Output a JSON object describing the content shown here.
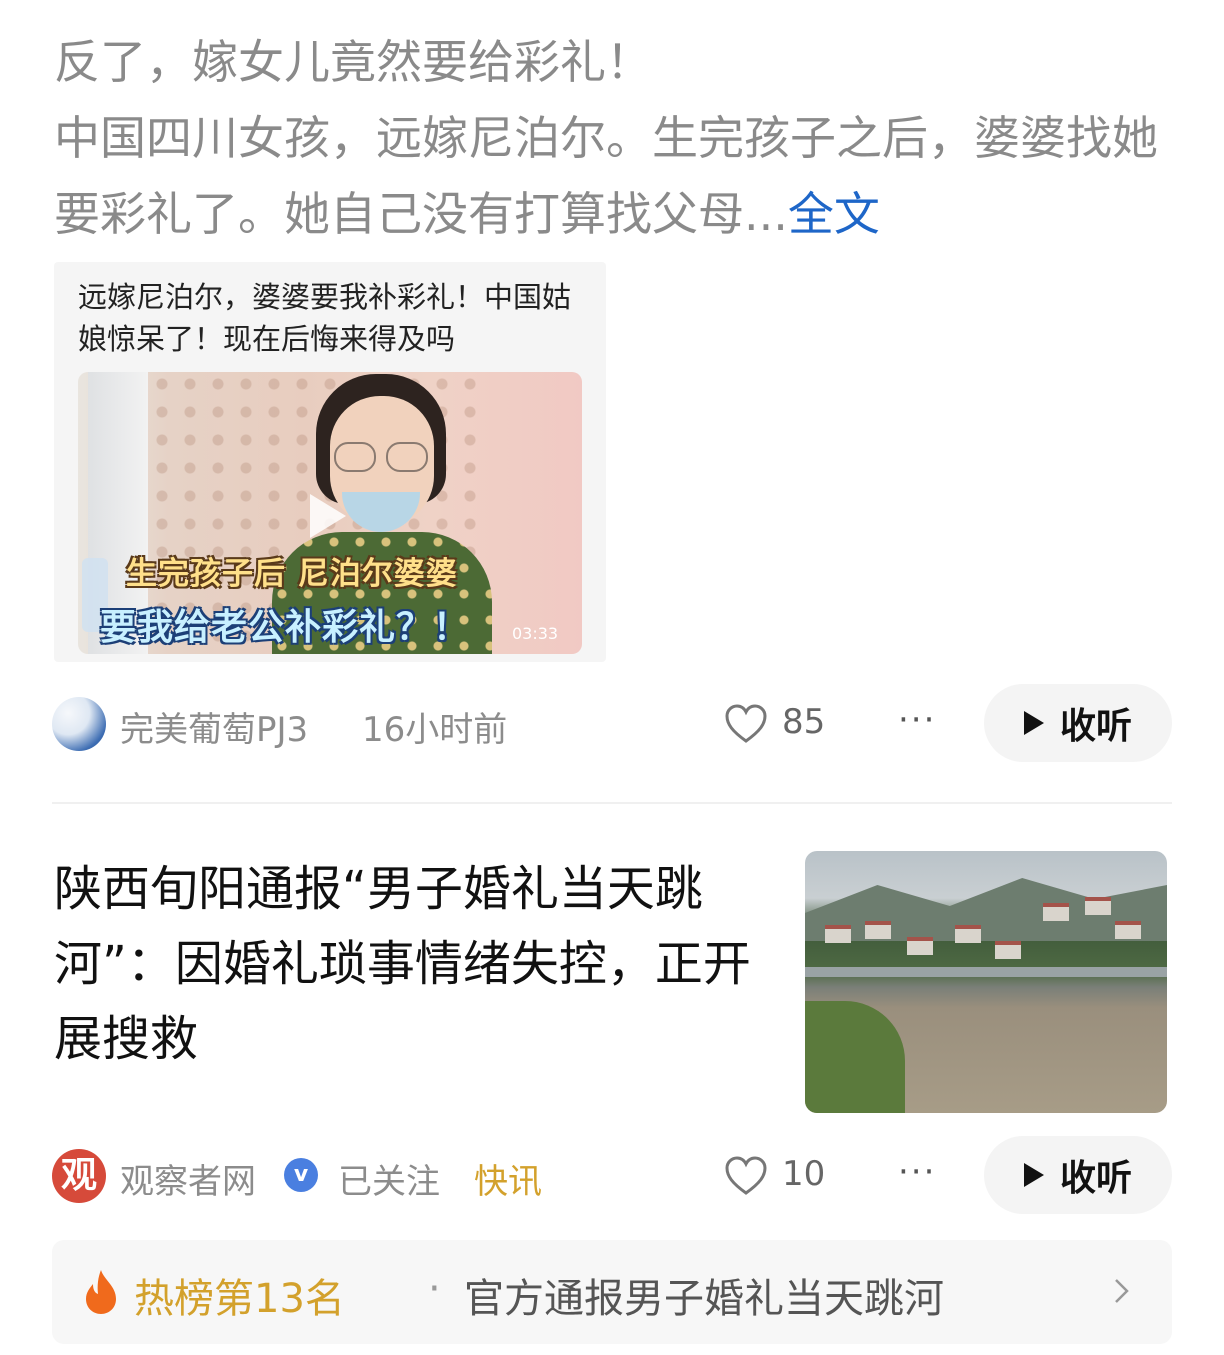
{
  "post1": {
    "title": "反了，嫁女儿竟然要给彩礼！",
    "body": "中国四川女孩，远嫁尼泊尔。生完孩子之后，婆婆找她要彩礼了。她自己没有打算找父母...",
    "full_text_link": "全文",
    "quote_card": {
      "title": "远嫁尼泊尔，婆婆要我补彩礼！中国姑娘惊呆了！现在后悔来得及吗",
      "caption_line1": "生完孩子后 尼泊尔婆婆",
      "caption_line2": "要我给老公补彩礼？！",
      "duration": "03:33"
    },
    "author": "完美葡萄PJ3",
    "time": "16小时前",
    "likes": "85",
    "more": "···",
    "listen_label": "收听"
  },
  "post2": {
    "title": "陕西旬阳通报“男子婚礼当天跳河”：因婚礼琐事情绪失控，正开展搜救",
    "author": "观察者网",
    "avatar_char": "观",
    "verified": "v",
    "follow_status": "已关注",
    "tag": "快讯",
    "likes": "10",
    "more": "···",
    "listen_label": "收听"
  },
  "hot_bar": {
    "rank": "热榜第13名",
    "separator": "·",
    "text": "官方通报男子婚礼当天跳河"
  },
  "colors": {
    "link": "#1e66c8",
    "tag": "#d3a12c",
    "fire": "#f06a1c"
  }
}
